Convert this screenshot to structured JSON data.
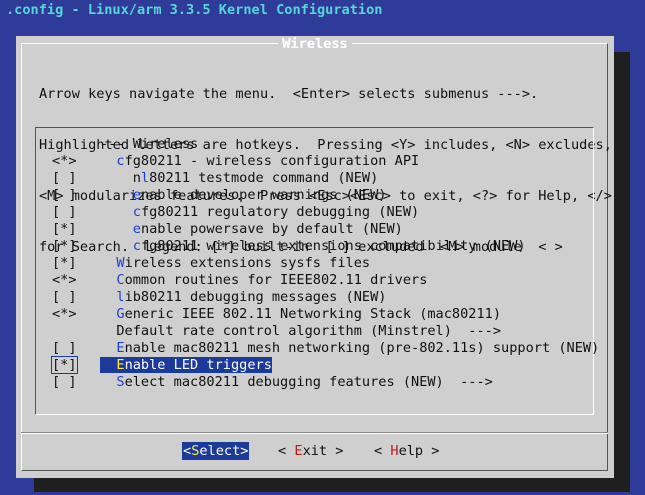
{
  "window": {
    "title": ".config - Linux/arm 3.3.5 Kernel Configuration"
  },
  "dialog": {
    "title": "Wireless",
    "instructions": [
      "Arrow keys navigate the menu.  <Enter> selects submenus --->.",
      "Highlighted letters are hotkeys.  Pressing <Y> includes, <N> excludes,",
      "<M> modularizes features.  Press <Esc><Esc> to exit, <?> for Help, </>",
      "for Search.  Legend: [*] built-in  [ ] excluded  <M> module  < >"
    ]
  },
  "menu": {
    "items": [
      {
        "mark": "",
        "pre": "--- Wireless",
        "hot": "",
        "rest": ""
      },
      {
        "mark": "<*>",
        "pre": "  ",
        "hot": "c",
        "rest": "fg80211 - wireless configuration API"
      },
      {
        "mark": "[ ]",
        "pre": "    n",
        "hot": "l",
        "rest": "80211 testmode command (NEW)"
      },
      {
        "mark": "[ ]",
        "pre": "    ",
        "hot": "e",
        "rest": "nable developer warnings (NEW)"
      },
      {
        "mark": "[ ]",
        "pre": "    ",
        "hot": "c",
        "rest": "fg80211 regulatory debugging (NEW)"
      },
      {
        "mark": "[*]",
        "pre": "    ",
        "hot": "e",
        "rest": "nable powersave by default (NEW)"
      },
      {
        "mark": "[*]",
        "pre": "    ",
        "hot": "c",
        "rest": "fg80211 wireless extensions compatibility (NEW)"
      },
      {
        "mark": "[*]",
        "pre": "  ",
        "hot": "W",
        "rest": "ireless extensions sysfs files"
      },
      {
        "mark": "<*>",
        "pre": "  ",
        "hot": "C",
        "rest": "ommon routines for IEEE802.11 drivers"
      },
      {
        "mark": "[ ]",
        "pre": "  ",
        "hot": "l",
        "rest": "ib80211 debugging messages (NEW)"
      },
      {
        "mark": "<*>",
        "pre": "  ",
        "hot": "G",
        "rest": "eneric IEEE 802.11 Networking Stack (mac80211)"
      },
      {
        "mark": "",
        "pre": "  ",
        "hot": "",
        "rest": "Default rate control algorithm (Minstrel)  --->"
      },
      {
        "mark": "[ ]",
        "pre": "  ",
        "hot": "E",
        "rest": "nable mac80211 mesh networking (pre-802.11s) support (NEW)"
      },
      {
        "mark": "[*]",
        "pre": "  ",
        "hot": "E",
        "rest": "nable LED triggers",
        "selected": true
      },
      {
        "mark": "[ ]",
        "pre": "  ",
        "hot": "S",
        "rest": "elect mac80211 debugging features (NEW)  --->"
      }
    ]
  },
  "buttons": {
    "select": {
      "open": "<",
      "hot": "S",
      "rest": "elect",
      "close": ">"
    },
    "exit": {
      "open": "< ",
      "hot": "E",
      "rest": "xit",
      "close": " >"
    },
    "help": {
      "open": "< ",
      "hot": "H",
      "rest": "elp",
      "close": " >"
    }
  },
  "colors": {
    "background": "#2e3b99",
    "dialog": "#cfcfcf",
    "title_text": "#56d7d7",
    "highlight": "#1c3a9a",
    "hotkey": "#1d3dd1",
    "button_hotkey": "#c21a1a"
  }
}
